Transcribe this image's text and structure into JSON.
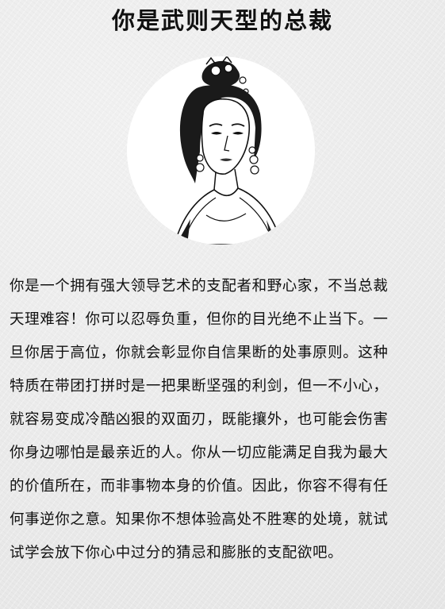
{
  "title": "你是武则天型的总裁",
  "portrait": {
    "icon": "empress-portrait-illustration"
  },
  "body": {
    "lines": [
      "你是一个拥有强大领导艺术的支配者和野心家，不当总裁",
      "天理难容！你可以忍辱负重，但你的目光绝不止当下。一",
      "旦你居于高位，你就会彰显你自信果断的处事原则。这种",
      "特质在带团打拼时是一把果断坚强的利剑，但一不小心，",
      "就容易变成冷酷凶狠的双面刃，既能攘外，也可能会伤害",
      "你身边哪怕是最亲近的人。你从一切应能满足自我为最大",
      "的价值所在，而非事物本身的价值。因此，你容不得有任",
      "何事逆你之意。知果你不想体验高处不胜寒的处境，就试",
      "试学会放下你心中过分的猜忌和膨胀的支配欲吧。"
    ]
  }
}
